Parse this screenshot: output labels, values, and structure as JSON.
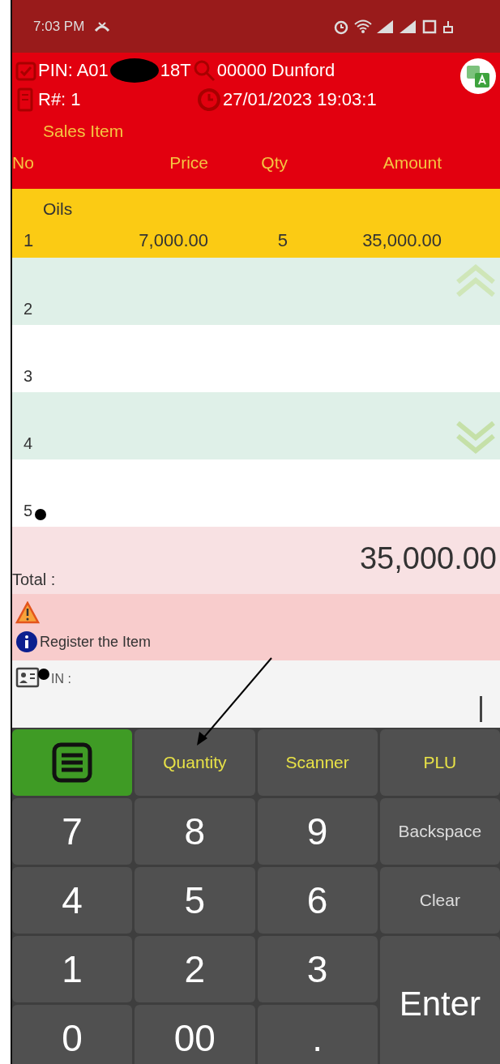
{
  "status_bar": {
    "time": "7:03 PM"
  },
  "header": {
    "pin_prefix": "PIN: A01",
    "pin_suffix": "18T",
    "customer": "00000 Dunford",
    "receipt": "R#: 1",
    "datetime": "27/01/2023 19:03:1",
    "section": "Sales Item"
  },
  "table": {
    "columns": [
      "No",
      "Price",
      "Qty",
      "Amount"
    ],
    "rows": [
      {
        "category": "Oils",
        "no": "1",
        "price": "7,000.00",
        "qty": "5",
        "amount": "35,000.00",
        "selected": true
      },
      {
        "no": "2",
        "selected": false
      },
      {
        "no": "3",
        "selected": false
      },
      {
        "no": "4",
        "selected": false
      },
      {
        "no": "5",
        "selected": false
      }
    ]
  },
  "total": {
    "label": "Total :",
    "value": "35,000.00"
  },
  "messages": [
    {
      "kind": "warning"
    },
    {
      "kind": "info",
      "text": "Register the Item"
    }
  ],
  "input": {
    "label": "IN :"
  },
  "keypad": [
    {
      "kind": "menu"
    },
    {
      "kind": "mode",
      "label": "Quantity"
    },
    {
      "kind": "mode",
      "label": "Scanner"
    },
    {
      "kind": "mode",
      "label": "PLU"
    },
    {
      "kind": "digit",
      "label": "7"
    },
    {
      "kind": "digit",
      "label": "8"
    },
    {
      "kind": "digit",
      "label": "9"
    },
    {
      "kind": "action",
      "label": "Backspace"
    },
    {
      "kind": "digit",
      "label": "4"
    },
    {
      "kind": "digit",
      "label": "5"
    },
    {
      "kind": "digit",
      "label": "6"
    },
    {
      "kind": "action",
      "label": "Clear"
    },
    {
      "kind": "digit",
      "label": "1"
    },
    {
      "kind": "digit",
      "label": "2"
    },
    {
      "kind": "digit",
      "label": "3"
    },
    {
      "kind": "enter",
      "label": "Enter"
    },
    {
      "kind": "digit",
      "label": "0"
    },
    {
      "kind": "digit",
      "label": "00"
    },
    {
      "kind": "digit",
      "label": "."
    }
  ]
}
